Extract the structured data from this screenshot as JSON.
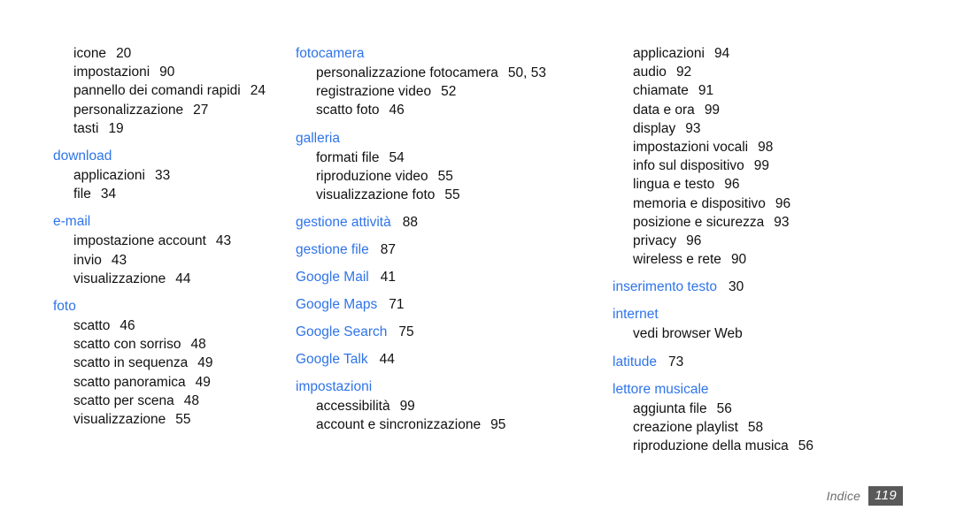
{
  "page": {
    "title": "Indice",
    "heading_color": "#2f74e8",
    "text_color": "#111111",
    "footer_badge_color": "#595959"
  },
  "footer": {
    "label": "Indice",
    "page_number": "119"
  },
  "columns": [
    {
      "id": "column-left",
      "blocks": [
        {
          "heading": null,
          "items": [
            {
              "term": "icone",
              "pages": "20"
            },
            {
              "term": "impostazioni",
              "pages": "90"
            },
            {
              "term": "pannello dei comandi rapidi",
              "pages": "24"
            },
            {
              "term": "personalizzazione",
              "pages": "27"
            },
            {
              "term": "tasti",
              "pages": "19"
            }
          ]
        },
        {
          "heading": {
            "term": "download",
            "pages": null
          },
          "items": [
            {
              "term": "applicazioni",
              "pages": "33"
            },
            {
              "term": "file",
              "pages": "34"
            }
          ]
        },
        {
          "heading": {
            "term": "e-mail",
            "pages": null
          },
          "items": [
            {
              "term": "impostazione account",
              "pages": "43"
            },
            {
              "term": "invio",
              "pages": "43"
            },
            {
              "term": "visualizzazione",
              "pages": "44"
            }
          ]
        },
        {
          "heading": {
            "term": "foto",
            "pages": null
          },
          "items": [
            {
              "term": "scatto",
              "pages": "46"
            },
            {
              "term": "scatto con sorriso",
              "pages": "48"
            },
            {
              "term": "scatto in sequenza",
              "pages": "49"
            },
            {
              "term": "scatto panoramica",
              "pages": "49"
            },
            {
              "term": "scatto per scena",
              "pages": "48"
            },
            {
              "term": "visualizzazione",
              "pages": "55"
            }
          ]
        }
      ]
    },
    {
      "id": "column-middle",
      "blocks": [
        {
          "heading": {
            "term": "fotocamera",
            "pages": null
          },
          "items": [
            {
              "term": "personalizzazione fotocamera",
              "pages": "50, 53"
            },
            {
              "term": "registrazione video",
              "pages": "52"
            },
            {
              "term": "scatto foto",
              "pages": "46"
            }
          ]
        },
        {
          "heading": {
            "term": "galleria",
            "pages": null
          },
          "items": [
            {
              "term": "formati file",
              "pages": "54"
            },
            {
              "term": "riproduzione video",
              "pages": "55"
            },
            {
              "term": "visualizzazione foto",
              "pages": "55"
            }
          ]
        },
        {
          "heading": {
            "term": "gestione attività",
            "pages": "88"
          },
          "items": []
        },
        {
          "heading": {
            "term": "gestione file",
            "pages": "87"
          },
          "items": []
        },
        {
          "heading": {
            "term": "Google Mail",
            "pages": "41"
          },
          "items": []
        },
        {
          "heading": {
            "term": "Google Maps",
            "pages": "71"
          },
          "items": []
        },
        {
          "heading": {
            "term": "Google Search",
            "pages": "75"
          },
          "items": []
        },
        {
          "heading": {
            "term": "Google Talk",
            "pages": "44"
          },
          "items": []
        },
        {
          "heading": {
            "term": "impostazioni",
            "pages": null
          },
          "items": [
            {
              "term": "accessibilità",
              "pages": "99"
            },
            {
              "term": "account e sincronizzazione",
              "pages": "95"
            }
          ]
        }
      ]
    },
    {
      "id": "column-right",
      "blocks": [
        {
          "heading": null,
          "items": [
            {
              "term": "applicazioni",
              "pages": "94"
            },
            {
              "term": "audio",
              "pages": "92"
            },
            {
              "term": "chiamate",
              "pages": "91"
            },
            {
              "term": "data e ora",
              "pages": "99"
            },
            {
              "term": "display",
              "pages": "93"
            },
            {
              "term": "impostazioni vocali",
              "pages": "98"
            },
            {
              "term": "info sul dispositivo",
              "pages": "99"
            },
            {
              "term": "lingua e testo",
              "pages": "96"
            },
            {
              "term": "memoria e dispositivo",
              "pages": "96"
            },
            {
              "term": "posizione e sicurezza",
              "pages": "93"
            },
            {
              "term": "privacy",
              "pages": "96"
            },
            {
              "term": "wireless e rete",
              "pages": "90"
            }
          ]
        },
        {
          "heading": {
            "term": "inserimento testo",
            "pages": "30"
          },
          "items": []
        },
        {
          "heading": {
            "term": "internet",
            "pages": null
          },
          "items": [
            {
              "term": "vedi browser Web",
              "pages": null
            }
          ]
        },
        {
          "heading": {
            "term": "latitude",
            "pages": "73"
          },
          "items": []
        },
        {
          "heading": {
            "term": "lettore musicale",
            "pages": null
          },
          "items": [
            {
              "term": "aggiunta file",
              "pages": "56"
            },
            {
              "term": "creazione playlist",
              "pages": "58"
            },
            {
              "term": "riproduzione della musica",
              "pages": "56"
            }
          ]
        }
      ]
    }
  ]
}
